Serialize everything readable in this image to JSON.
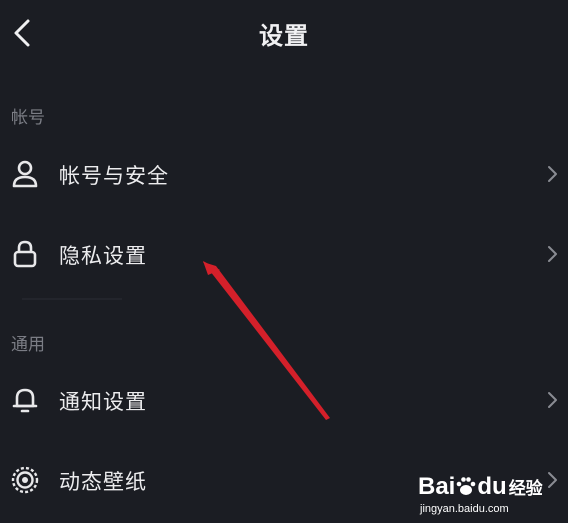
{
  "header": {
    "title": "设置"
  },
  "sections": [
    {
      "label": "帐号",
      "items": [
        {
          "label": "帐号与安全",
          "icon": "user-icon"
        },
        {
          "label": "隐私设置",
          "icon": "lock-icon"
        }
      ]
    },
    {
      "label": "通用",
      "items": [
        {
          "label": "通知设置",
          "icon": "bell-icon"
        },
        {
          "label": "动态壁纸",
          "icon": "live-wallpaper-icon"
        }
      ]
    }
  ],
  "annotation": {
    "arrow_color": "#d4202a"
  },
  "watermark": {
    "brand_prefix": "Bai",
    "brand_suffix": "du",
    "product": "经验",
    "url": "jingyan.baidu.com"
  },
  "colors": {
    "background": "#1b1d23",
    "text": "#ececee",
    "muted": "#7b7d85"
  }
}
